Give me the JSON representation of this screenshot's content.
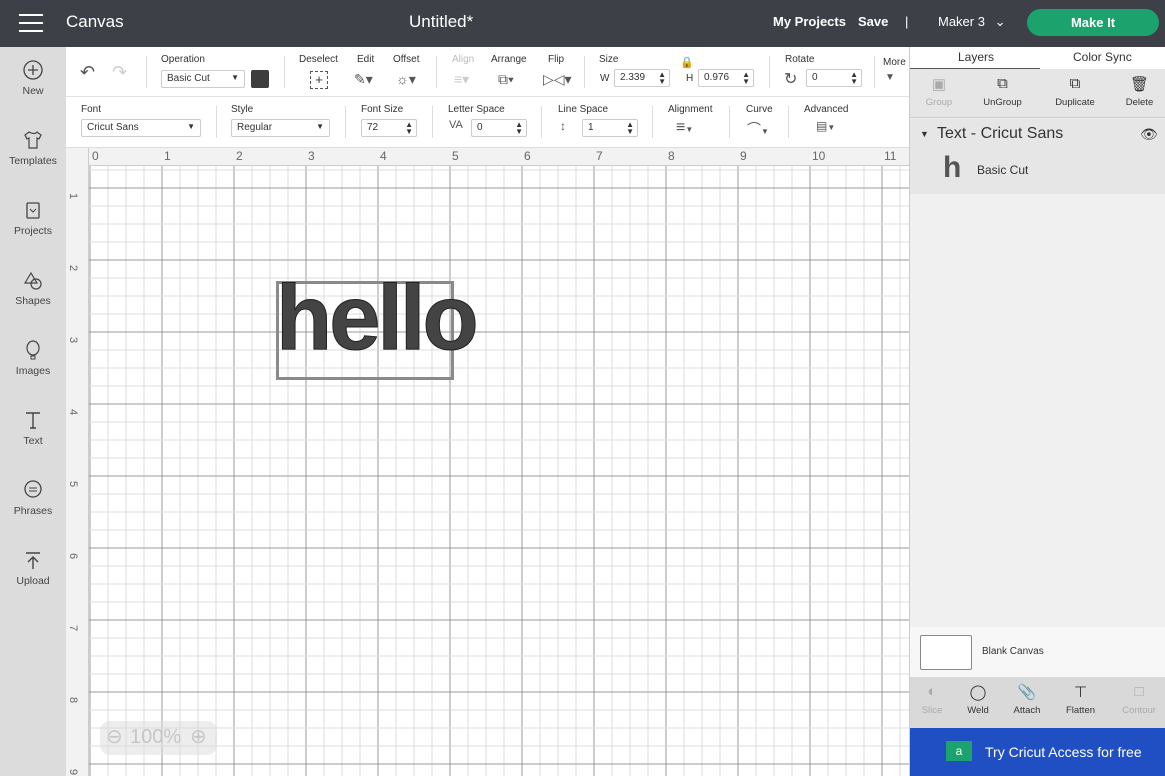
{
  "topbar": {
    "app_title": "Canvas",
    "doc_title": "Untitled*",
    "my_projects": "My Projects",
    "save": "Save",
    "separator": "|",
    "machine": "Maker 3",
    "make_it": "Make It"
  },
  "leftbar": [
    {
      "label": "New",
      "icon": "plus-circle-icon"
    },
    {
      "label": "Templates",
      "icon": "tshirt-icon"
    },
    {
      "label": "Projects",
      "icon": "project-book-icon"
    },
    {
      "label": "Shapes",
      "icon": "shapes-icon"
    },
    {
      "label": "Images",
      "icon": "balloon-icon"
    },
    {
      "label": "Text",
      "icon": "text-t-icon"
    },
    {
      "label": "Phrases",
      "icon": "speech-bubble-icon"
    },
    {
      "label": "Upload",
      "icon": "upload-icon"
    }
  ],
  "toolbar1": {
    "operation_label": "Operation",
    "operation_value": "Basic Cut",
    "operation_color": "#3d3d3d",
    "deselect": "Deselect",
    "edit": "Edit",
    "offset": "Offset",
    "align": "Align",
    "arrange": "Arrange",
    "flip": "Flip",
    "size": "Size",
    "w_label": "W",
    "w_value": "2.339",
    "h_label": "H",
    "h_value": "0.976",
    "rotate": "Rotate",
    "rotate_value": "0",
    "more": "More"
  },
  "toolbar2": {
    "font_label": "Font",
    "font_value": "Cricut Sans",
    "style_label": "Style",
    "style_value": "Regular",
    "font_size_label": "Font Size",
    "font_size_value": "72",
    "letter_space_label": "Letter Space",
    "letter_space_value": "0",
    "line_space_label": "Line Space",
    "line_space_value": "1",
    "alignment_label": "Alignment",
    "curve_label": "Curve",
    "advanced_label": "Advanced"
  },
  "canvas": {
    "ruler_top": [
      "0",
      "1",
      "2",
      "3",
      "4",
      "5",
      "6",
      "7",
      "8",
      "9",
      "10",
      "11"
    ],
    "ruler_left": [
      "1",
      "2",
      "3",
      "4",
      "5",
      "6",
      "7",
      "8",
      "9"
    ],
    "text_object": "hello",
    "zoom": "100%"
  },
  "rightpanel": {
    "tabs": [
      "Layers",
      "Color Sync"
    ],
    "actions": [
      {
        "label": "Group",
        "enabled": false
      },
      {
        "label": "UnGroup",
        "enabled": true
      },
      {
        "label": "Duplicate",
        "enabled": true
      },
      {
        "label": "Delete",
        "enabled": true
      }
    ],
    "layer_group": "Text - Cricut Sans",
    "layer_item_glyph": "h",
    "layer_item_label": "Basic Cut",
    "blank_canvas": "Blank Canvas",
    "bottom_tools": [
      {
        "label": "Slice",
        "enabled": false
      },
      {
        "label": "Weld",
        "enabled": true
      },
      {
        "label": "Attach",
        "enabled": true
      },
      {
        "label": "Flatten",
        "enabled": true
      },
      {
        "label": "Contour",
        "enabled": false
      }
    ],
    "promo": "Try Cricut Access for free",
    "promo_color": "#1f4fc2"
  }
}
